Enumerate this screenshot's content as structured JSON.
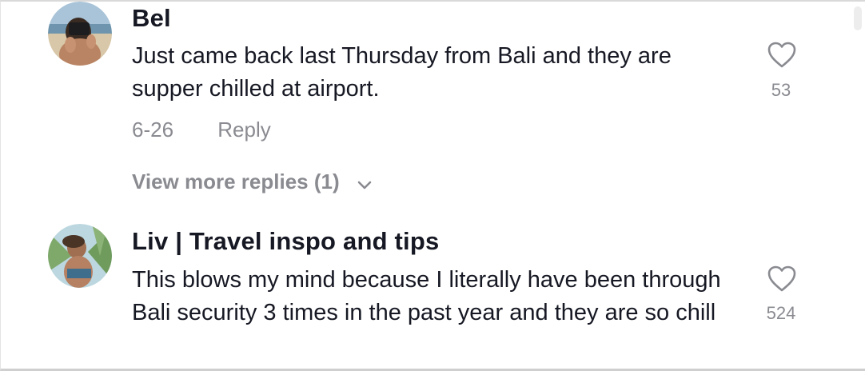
{
  "comments": [
    {
      "username": "Bel",
      "text": "Just came back last Thursday from Bali and they are supper chilled at airport.",
      "likes": "53",
      "date": "6-26",
      "reply_label": "Reply",
      "view_more_label": "View more replies (1)"
    },
    {
      "username": "Liv | Travel inspo and tips",
      "text": "This blows my mind because I literally have been through Bali security 3 times in the past year and they are so chill",
      "likes": "524"
    }
  ],
  "icons": {
    "like": "heart-outline-icon",
    "expand": "chevron-down-icon"
  },
  "colors": {
    "primary_text": "#161823",
    "secondary_text": "#8a8b91",
    "background": "#ffffff"
  }
}
